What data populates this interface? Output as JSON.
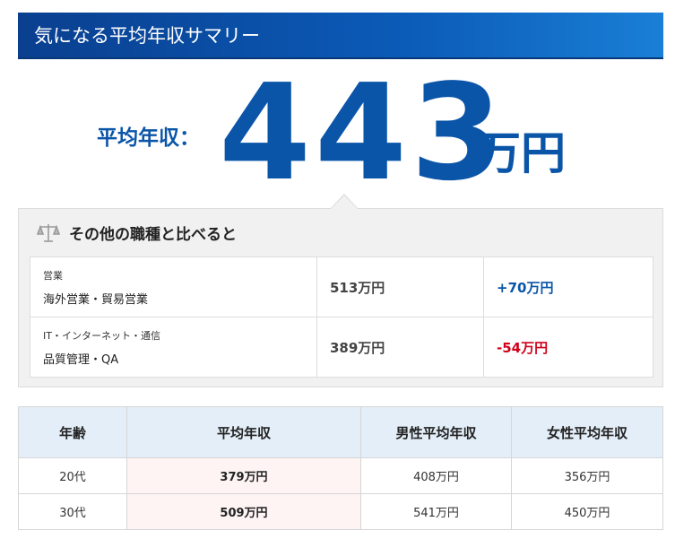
{
  "header": {
    "title": "気になる平均年収サマリー"
  },
  "summary": {
    "label": "平均年収：",
    "value": "443",
    "unit": "万円"
  },
  "compare": {
    "title": "その他の職種と比べると",
    "rows": [
      {
        "category": "営業",
        "job": "海外営業・貿易営業",
        "salary": "513万円",
        "diff": "+70万円",
        "sign": "positive"
      },
      {
        "category": "IT・インターネット・通信",
        "job": "品質管理・QA",
        "salary": "389万円",
        "diff": "-54万円",
        "sign": "negative"
      }
    ]
  },
  "age_table": {
    "headers": [
      "年齢",
      "平均年収",
      "男性平均年収",
      "女性平均年収"
    ],
    "rows": [
      [
        "20代",
        "379万円",
        "408万円",
        "356万円"
      ],
      [
        "30代",
        "509万円",
        "541万円",
        "450万円"
      ]
    ]
  },
  "colors": {
    "brand": "#0a55a8",
    "negative": "#d0021b",
    "header_bg": "#e3eef8"
  }
}
